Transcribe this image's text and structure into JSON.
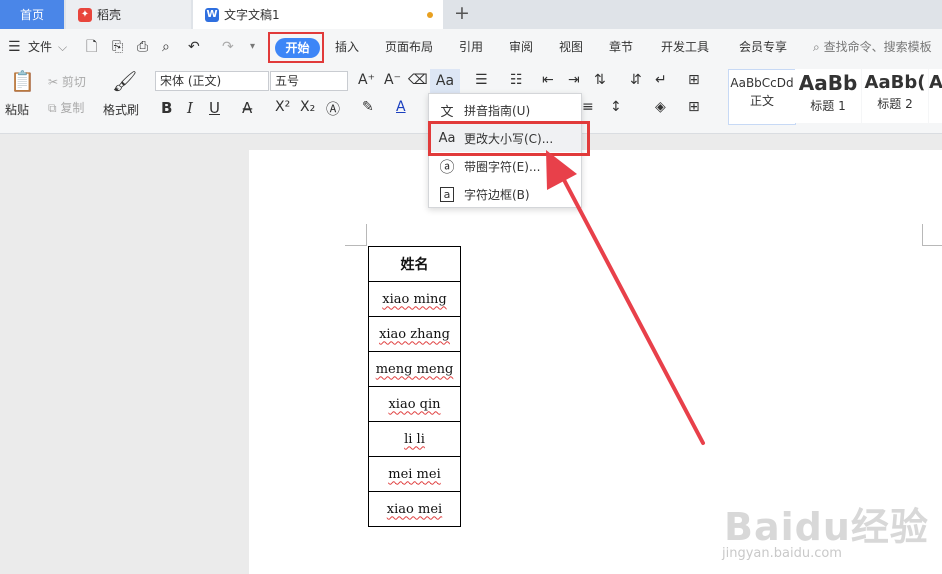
{
  "tabs": {
    "home": "首页",
    "daoke": "稻壳",
    "doc": "文字文稿1",
    "new_tab_icon": "+",
    "colors": {
      "active": "#4a86e8",
      "unsaved_dot": "#e8a020"
    }
  },
  "commands": {
    "file": "文件",
    "start": "开始",
    "insert": "插入",
    "layout": "页面布局",
    "reference": "引用",
    "review": "审阅",
    "view": "视图",
    "section": "章节",
    "devtools": "开发工具",
    "member": "会员专享",
    "search_placeholder": "查找命令、搜索模板"
  },
  "ribbon": {
    "paste": "粘贴",
    "cut": "剪切",
    "copy": "复制",
    "format_painter": "格式刷",
    "font_name": "宋体 (正文)",
    "font_size": "五号",
    "case_button": "Aa",
    "styles": [
      {
        "sample": "AaBbCcDd",
        "name": "正文"
      },
      {
        "sample": "AaBb",
        "name": "标题 1"
      },
      {
        "sample": "AaBb(",
        "name": "标题 2"
      },
      {
        "sample": "Aa",
        "name": ""
      }
    ]
  },
  "dropdown": {
    "items": [
      {
        "icon": "文",
        "label": "拼音指南(U)"
      },
      {
        "icon": "Aa",
        "label": "更改大小写(C)..."
      },
      {
        "icon": "ⓐ",
        "label": "带圈字符(E)..."
      },
      {
        "icon": "a",
        "label": "字符边框(B)"
      }
    ]
  },
  "table": {
    "header": "姓名",
    "rows": [
      "xiao ming",
      "xiao zhang",
      "meng meng",
      "xiao qin",
      "li li",
      "mei mei",
      "xiao mei"
    ]
  },
  "annotation_color": "#e13a3a",
  "watermark": {
    "main": "Baidu经验",
    "sub": "jingyan.baidu.com"
  }
}
